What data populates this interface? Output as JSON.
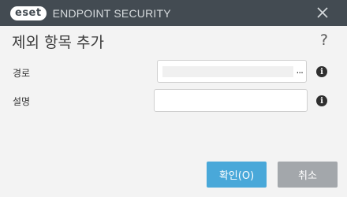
{
  "titlebar": {
    "logo_text": "eset",
    "product_title": "ENDPOINT SECURITY",
    "close_icon": "close-icon"
  },
  "dialog": {
    "title": "제외 항목 추가",
    "help_symbol": "?"
  },
  "form": {
    "path_label": "경로",
    "path_value": "",
    "browse_label": "...",
    "description_label": "설명",
    "description_value": "",
    "info_symbol": "i"
  },
  "buttons": {
    "ok_label": "확인(O)",
    "cancel_label": "취소"
  },
  "colors": {
    "titlebar": "#434b52",
    "primary": "#49a8d9",
    "secondary": "#a3a7ab",
    "background": "#f3f3f3"
  }
}
